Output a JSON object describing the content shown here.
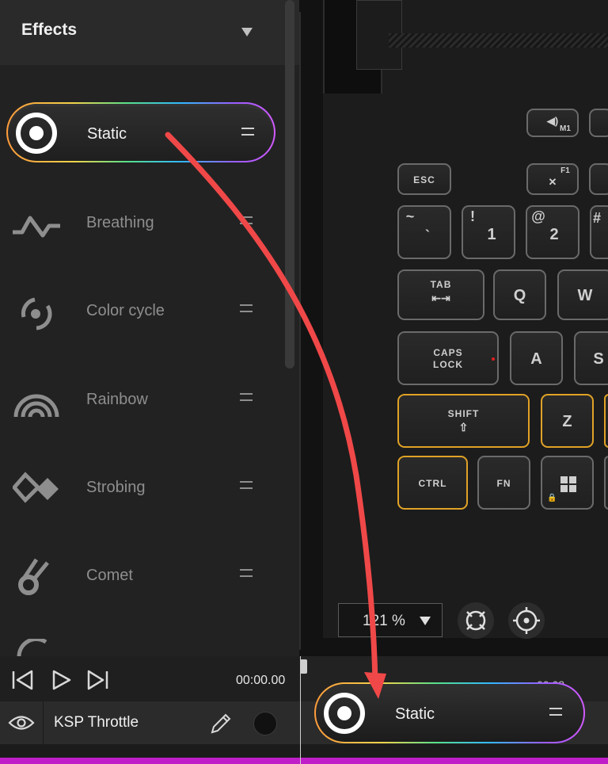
{
  "effects_panel": {
    "title": "Effects",
    "items": [
      {
        "label": "Static",
        "icon": "static-icon",
        "selected": true
      },
      {
        "label": "Breathing",
        "icon": "breathing-icon"
      },
      {
        "label": "Color cycle",
        "icon": "color-cycle-icon"
      },
      {
        "label": "Rainbow",
        "icon": "rainbow-icon"
      },
      {
        "label": "Strobing",
        "icon": "strobing-icon"
      },
      {
        "label": "Comet",
        "icon": "comet-icon"
      }
    ]
  },
  "keyboard": {
    "keys": {
      "esc": "ESC",
      "tilde_top": "~",
      "tilde_bottom": "`",
      "one_top": "!",
      "one_bottom": "1",
      "two_top": "@",
      "two_bottom": "2",
      "three_top": "#",
      "m1": "M1",
      "f1": "F1",
      "tab": "TAB",
      "q": "Q",
      "w": "W",
      "caps_line1": "CAPS",
      "caps_line2": "LOCK",
      "a": "A",
      "s": "S",
      "shift": "SHIFT",
      "z": "Z",
      "ctrl": "CTRL",
      "fn": "FN"
    },
    "highlight_color": "#e0a226"
  },
  "zoom": {
    "value": "121 %"
  },
  "timeline": {
    "timecode": "00:00.00",
    "track_name": "KSP Throttle",
    "ruler_partial": "00:02"
  },
  "drag_ghost": {
    "label": "Static"
  },
  "colors": {
    "accent_magenta": "#c01ec8",
    "annotation_arrow": "#f04848"
  }
}
